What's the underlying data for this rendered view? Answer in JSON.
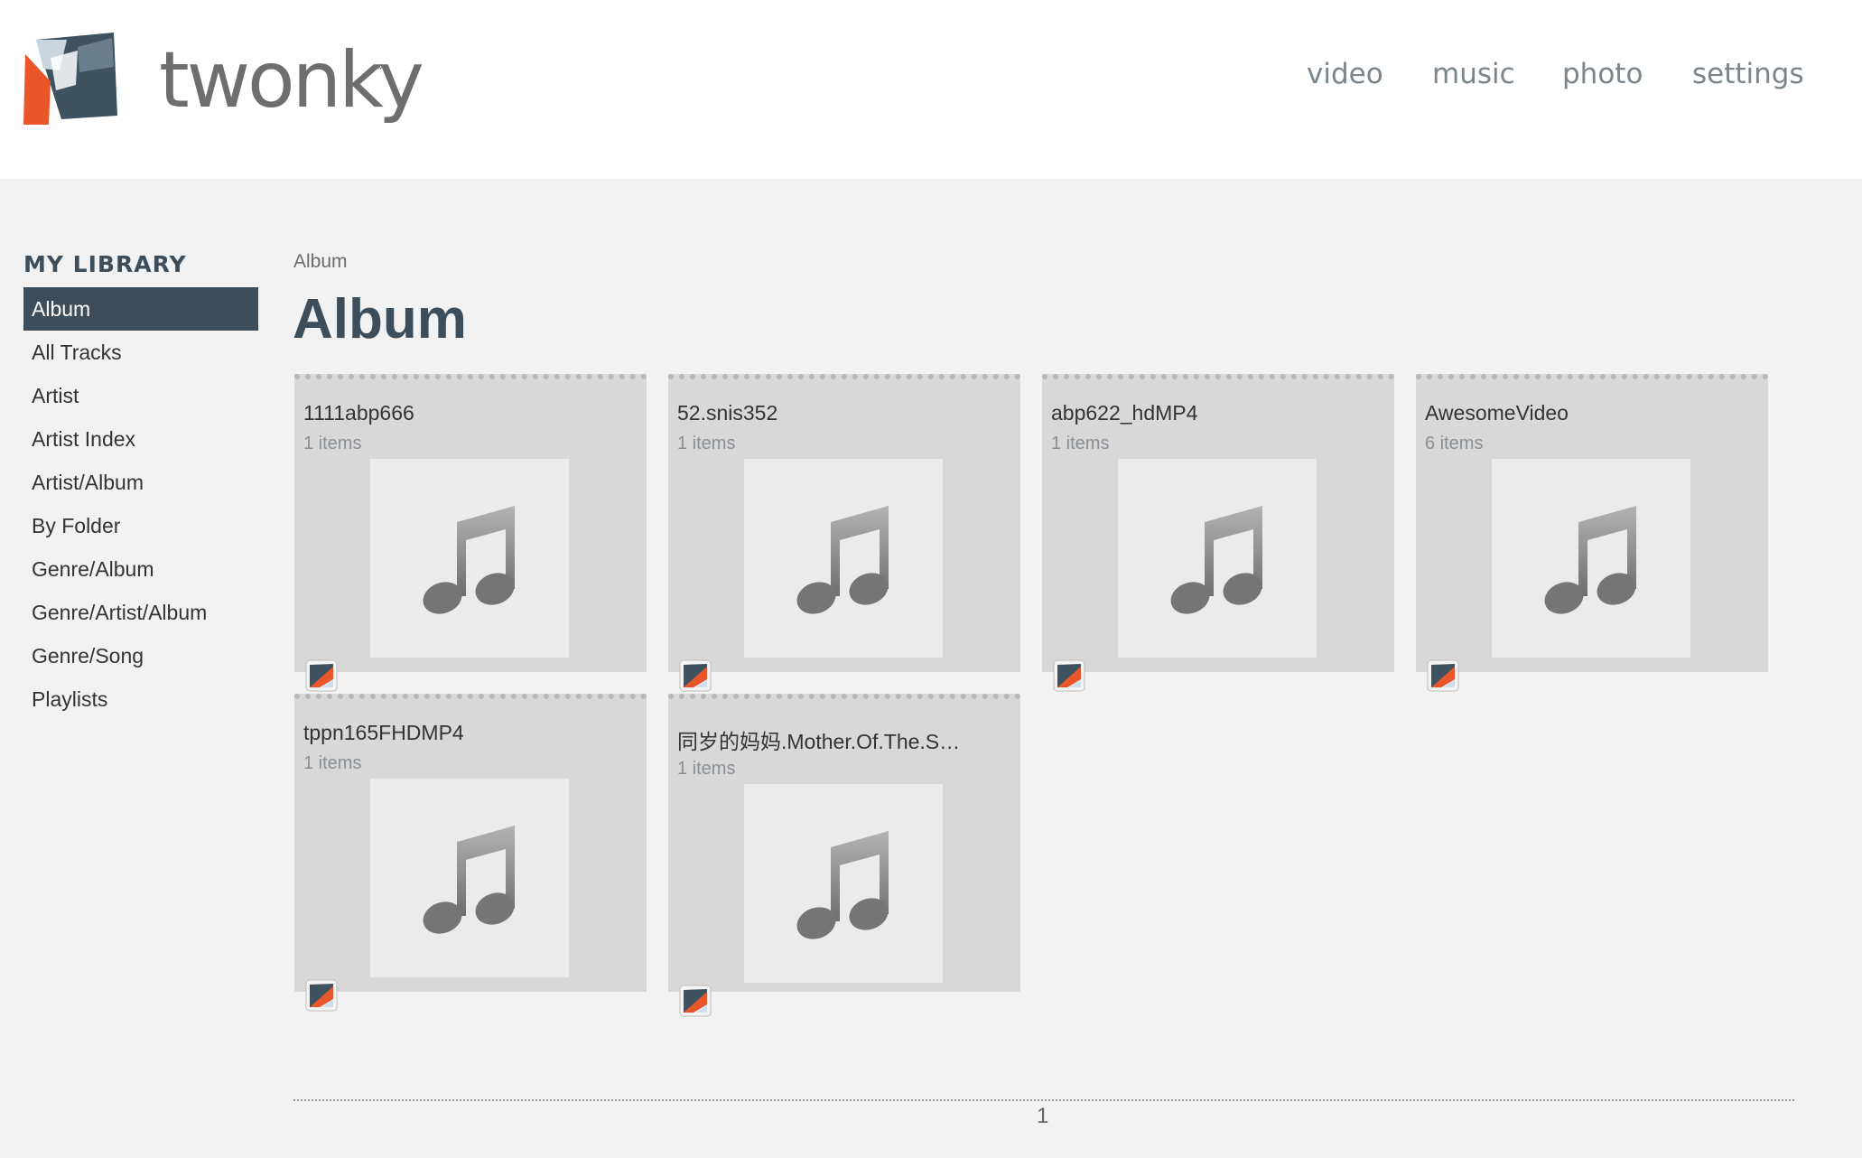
{
  "brand": {
    "name": "twonky",
    "tm": "™"
  },
  "nav": [
    {
      "id": "video",
      "label": "video"
    },
    {
      "id": "music",
      "label": "music"
    },
    {
      "id": "photo",
      "label": "photo"
    },
    {
      "id": "settings",
      "label": "settings"
    }
  ],
  "sidebar": {
    "title": "MY LIBRARY",
    "items": [
      {
        "label": "Album",
        "active": true
      },
      {
        "label": "All Tracks"
      },
      {
        "label": "Artist"
      },
      {
        "label": "Artist Index"
      },
      {
        "label": "Artist/Album"
      },
      {
        "label": "By Folder"
      },
      {
        "label": "Genre/Album"
      },
      {
        "label": "Genre/Artist/Album"
      },
      {
        "label": "Genre/Song"
      },
      {
        "label": "Playlists"
      }
    ]
  },
  "main": {
    "breadcrumb": "Album",
    "title": "Album",
    "cards": [
      {
        "title": "1111abp666",
        "count": "1 items"
      },
      {
        "title": "52.snis352",
        "count": "1 items"
      },
      {
        "title": "abp622_hdMP4",
        "count": "1 items"
      },
      {
        "title": "AwesomeVideo",
        "count": "6 items"
      },
      {
        "title": "tppn165FHDMP4",
        "count": "1 items"
      },
      {
        "title": "同岁的妈妈.Mother.Of.The.S…",
        "count": "1 items"
      }
    ]
  },
  "pagination": {
    "current": "1"
  },
  "colors": {
    "accent": "#3c4e5b",
    "brand_orange": "#e8562a",
    "card_bg": "#d8d8d8"
  },
  "icons": {
    "thumb": "music-note-icon",
    "badge": "twonky-badge-icon"
  }
}
